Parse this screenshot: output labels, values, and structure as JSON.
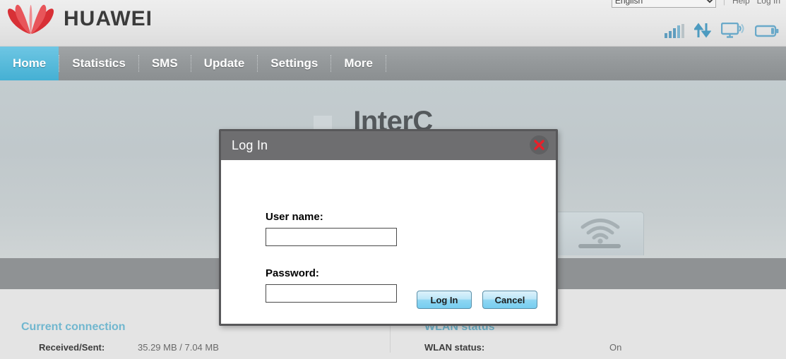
{
  "header": {
    "brand_text": "HUAWEI",
    "logo_icon": "huawei-flower-logo",
    "language": {
      "selected": "English",
      "options": [
        "English"
      ]
    },
    "help_label": "Help",
    "login_label": "Log In",
    "status_icons": [
      "signal-bars-icon",
      "data-transfer-arrows-icon",
      "connected-device-icon",
      "battery-icon"
    ]
  },
  "nav": {
    "items": [
      {
        "label": "Home",
        "active": true
      },
      {
        "label": "Statistics",
        "active": false
      },
      {
        "label": "SMS",
        "active": false
      },
      {
        "label": "Update",
        "active": false
      },
      {
        "label": "Settings",
        "active": false
      },
      {
        "label": "More",
        "active": false
      }
    ]
  },
  "main": {
    "internet_title": "InterC",
    "wifi_icon": "wifi-signal-icon"
  },
  "bottom": {
    "left": {
      "section_title": "Current connection",
      "rows": [
        {
          "label": "Received/Sent:",
          "value": "35.29 MB /  7.04 MB"
        }
      ]
    },
    "right": {
      "section_title": "WLAN status",
      "rows": [
        {
          "label": "WLAN status:",
          "value": "On"
        }
      ]
    }
  },
  "dialog": {
    "title": "Log In",
    "close_icon": "close-x-icon",
    "username_label": "User name:",
    "username_value": "",
    "username_placeholder": "",
    "password_label": "Password:",
    "password_value": "",
    "password_placeholder": "",
    "login_button": "Log In",
    "cancel_button": "Cancel"
  },
  "colors": {
    "accent_blue": "#57bada",
    "nav_gray": "#94989a",
    "section_title": "#71b7cf",
    "dialog_titlebar": "#6e6e70",
    "close_red": "#e8202a",
    "brand_red": "#d7262c"
  }
}
